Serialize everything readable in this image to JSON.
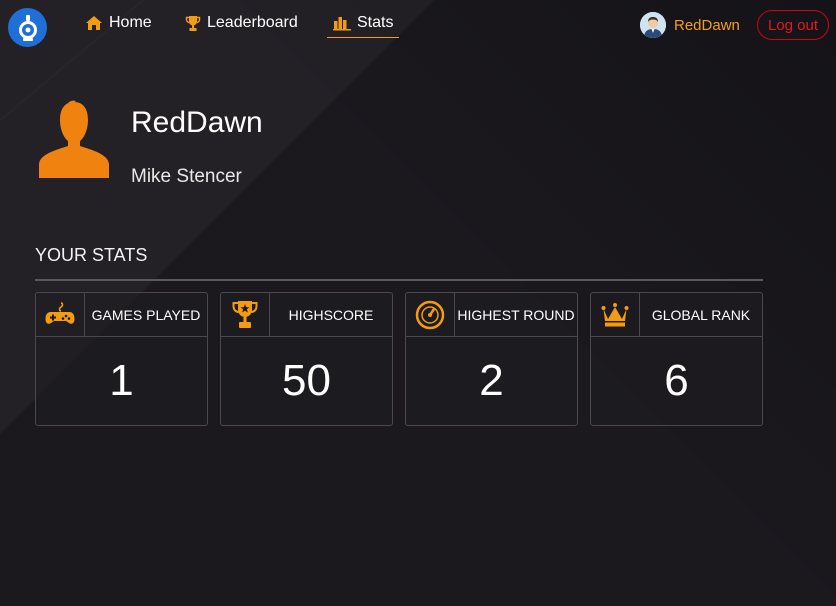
{
  "nav": {
    "home_label": "Home",
    "leaderboard_label": "Leaderboard",
    "stats_label": "Stats"
  },
  "user": {
    "username": "RedDawn",
    "logout_label": "Log out"
  },
  "profile": {
    "username": "RedDawn",
    "full_name": "Mike Stencer"
  },
  "stats": {
    "title": "YOUR STATS",
    "cards": [
      {
        "label": "GAMES PLAYED",
        "value": "1",
        "icon": "gamepad-icon"
      },
      {
        "label": "HIGHSCORE",
        "value": "50",
        "icon": "trophy-icon"
      },
      {
        "label": "HIGHEST ROUND",
        "value": "2",
        "icon": "speedometer-icon"
      },
      {
        "label": "GLOBAL RANK",
        "value": "6",
        "icon": "crown-icon"
      }
    ]
  },
  "colors": {
    "accent": "#f39c12",
    "logout": "#e31b1b",
    "logo": "#1f6fd6",
    "background": "#1b191e"
  }
}
